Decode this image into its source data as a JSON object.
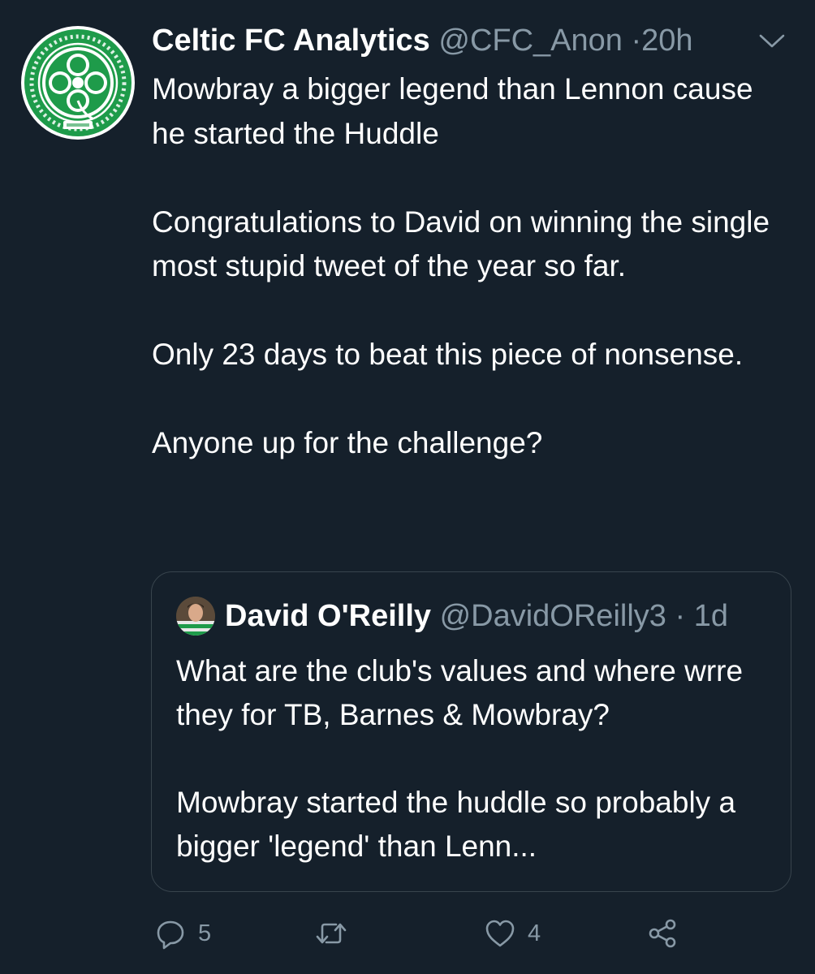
{
  "author": {
    "name": "Celtic FC Analytics",
    "handle": "@CFC_Anon",
    "separator": "·",
    "time": "20h",
    "avatar_icon": "celtic-fc-crest",
    "avatar_color": "#1e9b4a"
  },
  "tweet": {
    "paragraphs": [
      "Mowbray a bigger legend than Lennon cause he started the Huddle",
      "Congratulations to David on winning the single most stupid tweet of the year so far.",
      "Only 23 days to beat this piece of nonsense.",
      "Anyone up for the challenge?"
    ]
  },
  "quoted_tweet": {
    "name": "David O'Reilly",
    "handle": "@DavidOReilly3",
    "separator": "·",
    "time": "1d",
    "paragraphs": [
      "What are the club's values and where wrre they for TB, Barnes & Mowbray?",
      "Mowbray started the huddle so probably a bigger 'legend' than Lenn..."
    ]
  },
  "actions": {
    "reply_count": "5",
    "retweet_count": "",
    "like_count": "4",
    "icons": [
      "reply-icon",
      "retweet-icon",
      "like-icon",
      "share-icon"
    ]
  },
  "colors": {
    "background": "#15202b",
    "secondary_text": "#8899a6",
    "border": "#38444d",
    "celtic_green": "#1e9b4a"
  }
}
